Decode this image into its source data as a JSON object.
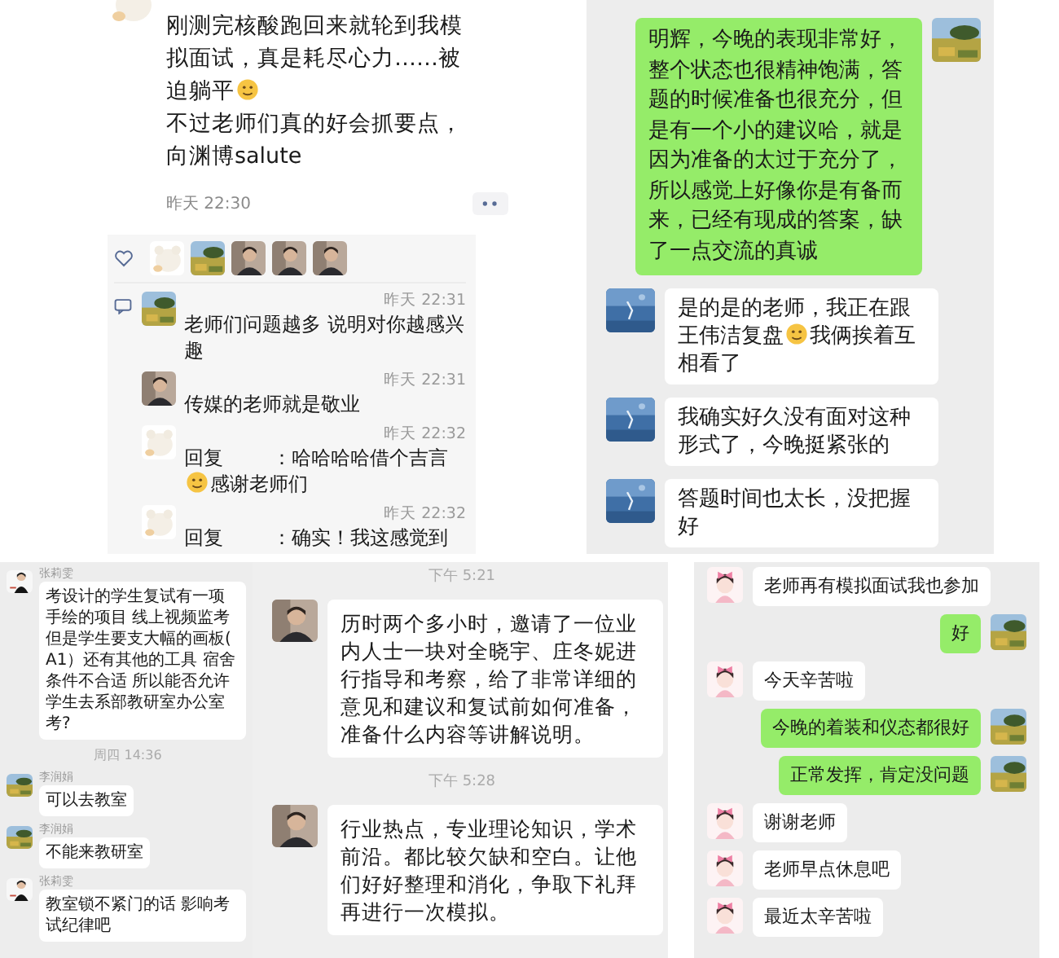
{
  "moment": {
    "avatar": {
      "kind": "cartoon"
    },
    "paragraphs": [
      {
        "segments": [
          {
            "kind": "text",
            "text": "刚测完核酸跑回来就轮到我模"
          },
          {
            "kind": "text",
            "text": "拟面试，真是耗尽心力……被"
          },
          {
            "kind": "text",
            "text": "迫躺平"
          },
          {
            "kind": "emoji"
          }
        ]
      },
      {
        "segments": [
          {
            "kind": "text",
            "text": "不过老师们真的好会抓要点，向渊博salute"
          }
        ]
      }
    ],
    "time": "昨天 22:30",
    "likes": [
      {
        "kind": "cartoon"
      },
      {
        "kind": "landscape"
      },
      {
        "kind": "person"
      },
      {
        "kind": "person"
      },
      {
        "kind": "person"
      }
    ],
    "comments": [
      {
        "avatar": {
          "kind": "landscape"
        },
        "time": "昨天 22:31",
        "segments": [
          {
            "kind": "text",
            "text": "老师们问题越多 说明对你越感兴趣"
          }
        ]
      },
      {
        "avatar": {
          "kind": "person"
        },
        "time": "昨天 22:31",
        "segments": [
          {
            "kind": "text",
            "text": "传媒的老师就是敬业"
          }
        ]
      },
      {
        "avatar": {
          "kind": "cartoon"
        },
        "time": "昨天 22:32",
        "reply_label": "回复",
        "segments": [
          {
            "kind": "text",
            "text": "：哈哈哈哈借个"
          },
          {
            "kind": "text",
            "text": "吉言"
          },
          {
            "kind": "emoji"
          },
          {
            "kind": "text",
            "text": "感谢老师们"
          }
        ]
      },
      {
        "avatar": {
          "kind": "cartoon"
        },
        "time": "昨天 22:32",
        "reply_label": "回复",
        "segments": [
          {
            "kind": "text",
            "text": "：确实！我这感觉到"
          }
        ]
      }
    ]
  },
  "chats": [
    {
      "items": [
        {
          "kind": "message",
          "outgoing": true,
          "avatar": {
            "kind": "landscape"
          },
          "segments": [
            {
              "kind": "text",
              "text": "明辉，今晚的表现非常好，整个状态也很精神饱满，答题的时候准备也很充分，但是有一个小的建议哈，就是因为准备的太过于充分了，所以感觉上好像你是有备而来，已经有现成的答案，缺了一点交流的真诚"
            }
          ]
        },
        {
          "kind": "message",
          "outgoing": false,
          "avatar": {
            "kind": "sky"
          },
          "segments": [
            {
              "kind": "text",
              "text": "是的是的老师，我正在跟"
            },
            {
              "kind": "text",
              "text": "王伟洁复盘"
            },
            {
              "kind": "emoji"
            },
            {
              "kind": "text",
              "text": "我俩挨着互"
            },
            {
              "kind": "text",
              "text": "相看了"
            }
          ]
        },
        {
          "kind": "message",
          "outgoing": false,
          "avatar": {
            "kind": "sky"
          },
          "segments": [
            {
              "kind": "text",
              "text": "我确实好久没有面对这种形式了，今晚挺紧张的"
            }
          ]
        },
        {
          "kind": "message",
          "outgoing": false,
          "avatar": {
            "kind": "sky"
          },
          "segments": [
            {
              "kind": "text",
              "text": "答题时间也太长，没把握好"
            }
          ]
        }
      ]
    },
    {
      "items": [
        {
          "kind": "message",
          "outgoing": false,
          "avatar": {
            "kind": "figure"
          },
          "sender": "张莉雯",
          "segments": [
            {
              "kind": "text",
              "text": "考设计的学生复试有一项手绘的项目 线上视频监考但是学生要支大幅的画板(A1）还有其他的工具 宿舍条件不合适 所以能否允许学生去系部教研室办公室考?"
            }
          ]
        },
        {
          "kind": "time",
          "text": "周四 14:36"
        },
        {
          "kind": "message",
          "outgoing": false,
          "avatar": {
            "kind": "landscape"
          },
          "sender": "李润娟",
          "segments": [
            {
              "kind": "text",
              "text": "可以去教室"
            }
          ]
        },
        {
          "kind": "message",
          "outgoing": false,
          "avatar": {
            "kind": "landscape"
          },
          "sender": "李润娟",
          "segments": [
            {
              "kind": "text",
              "text": "不能来教研室"
            }
          ]
        },
        {
          "kind": "message",
          "outgoing": false,
          "avatar": {
            "kind": "figure"
          },
          "sender": "张莉雯",
          "segments": [
            {
              "kind": "text",
              "text": "教室锁不紧门的话 影响考试纪律吧"
            }
          ]
        }
      ]
    },
    {
      "items": [
        {
          "kind": "time",
          "text": "下午 5:21"
        },
        {
          "kind": "message",
          "outgoing": false,
          "avatar": {
            "kind": "person"
          },
          "segments": [
            {
              "kind": "text",
              "text": "历时两个多小时，邀请了一位业内人士一块对全晓宇、庄冬妮进行指导和考察，给了非常详细的意见和建议和复试前如何准备，准备什么内容等讲解说明。"
            }
          ]
        },
        {
          "kind": "time",
          "text": "下午 5:28"
        },
        {
          "kind": "message",
          "outgoing": false,
          "avatar": {
            "kind": "person"
          },
          "segments": [
            {
              "kind": "text",
              "text": "行业热点，专业理论知识，学术前沿。都比较欠缺和空白。让他们好好整理和消化，争取下礼拜再进行一次模拟。"
            }
          ]
        }
      ]
    },
    {
      "items": [
        {
          "kind": "message",
          "outgoing": false,
          "avatar": {
            "kind": "girl"
          },
          "segments": [
            {
              "kind": "text",
              "text": "老师再有模拟面试我也参加"
            }
          ]
        },
        {
          "kind": "message",
          "outgoing": true,
          "avatar": {
            "kind": "landscape"
          },
          "segments": [
            {
              "kind": "text",
              "text": "好"
            }
          ]
        },
        {
          "kind": "message",
          "outgoing": false,
          "avatar": {
            "kind": "girl"
          },
          "segments": [
            {
              "kind": "text",
              "text": "今天辛苦啦"
            }
          ]
        },
        {
          "kind": "message",
          "outgoing": true,
          "avatar": {
            "kind": "landscape"
          },
          "segments": [
            {
              "kind": "text",
              "text": "今晚的着装和仪态都很好"
            }
          ]
        },
        {
          "kind": "message",
          "outgoing": true,
          "avatar": {
            "kind": "landscape"
          },
          "segments": [
            {
              "kind": "text",
              "text": "正常发挥，肯定没问题"
            }
          ]
        },
        {
          "kind": "message",
          "outgoing": false,
          "avatar": {
            "kind": "girl"
          },
          "segments": [
            {
              "kind": "text",
              "text": "谢谢老师"
            }
          ]
        },
        {
          "kind": "message",
          "outgoing": false,
          "avatar": {
            "kind": "girl"
          },
          "segments": [
            {
              "kind": "text",
              "text": "老师早点休息吧"
            }
          ]
        },
        {
          "kind": "message",
          "outgoing": false,
          "avatar": {
            "kind": "girl"
          },
          "segments": [
            {
              "kind": "text",
              "text": "最近太辛苦啦"
            }
          ]
        }
      ]
    }
  ]
}
